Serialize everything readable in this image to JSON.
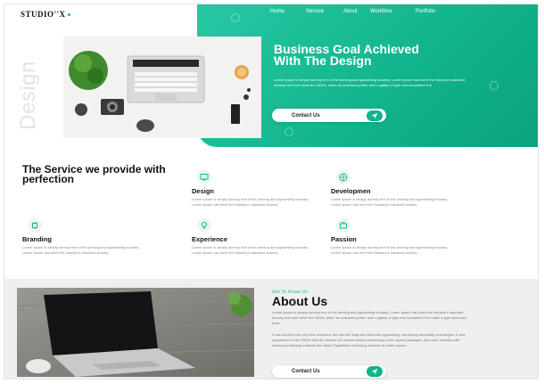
{
  "brand": {
    "logo": "STUDIO''X",
    "accent": "#16b890"
  },
  "nav": [
    "Home",
    "Service",
    "About",
    "Workflow",
    "Portfolio"
  ],
  "hero": {
    "watermark": "Design",
    "title": "Business Goal Achieved With The Design",
    "text": "Lorem Ipsum is simply dummy text of the printing and typesetting industry. Lorem Ipsum has been the industry's standard dummy text ever since the 1500s, when an unknown printer took a galley of type and scrambled it to",
    "button": "Contact Us",
    "button_icon": "send-icon"
  },
  "services": {
    "title": "The Service we provide with perfection",
    "items": [
      {
        "icon": "monitor-icon",
        "name": "Design",
        "desc": "Lorem Ipsum is simply dummy text of the printing and typesetting industry. Lorem Ipsum has been the industry's standard dummy."
      },
      {
        "icon": "globe-icon",
        "name": "Developmen",
        "desc": "Lorem Ipsum is simply dummy text of the printing and typesetting industry. Lorem Ipsum has been the industry's standard dummy."
      },
      {
        "icon": "chip-icon",
        "name": "Branding",
        "desc": "Lorem Ipsum is simply dummy text of the printing and typesetting industry. Lorem Ipsum has been the industry's standard dummy."
      },
      {
        "icon": "bulb-icon",
        "name": "Experience",
        "desc": "Lorem Ipsum is simply dummy text of the printing and typesetting industry. Lorem Ipsum has been the industry's standard dummy."
      },
      {
        "icon": "briefcase-icon",
        "name": "Passion",
        "desc": "Lorem Ipsum is simply dummy text of the printing and typesetting industry. Lorem Ipsum has been the industry's standard dummy."
      }
    ]
  },
  "about": {
    "kicker": "Get To Know Us",
    "title": "About Us",
    "p1": "Lorem Ipsum is simply dummy text of the printing and typesetting industry. Lorem Ipsum has been the industry's standard dummy text ever since the 1500s, when an unknown printer took a galley of type and scrambled it to make a type specimen book.",
    "p2": "It has survived not only five centuries, but also the leap into electronic typesetting, remaining essentially unchanged. It was popularised in the 1960s with the release of Letraset sheets containing Lorem Ipsum passages, and more recently with desktop publishing software like Aldus PageMaker including versions of Lorem Ipsum.",
    "button": "Contact Us"
  }
}
